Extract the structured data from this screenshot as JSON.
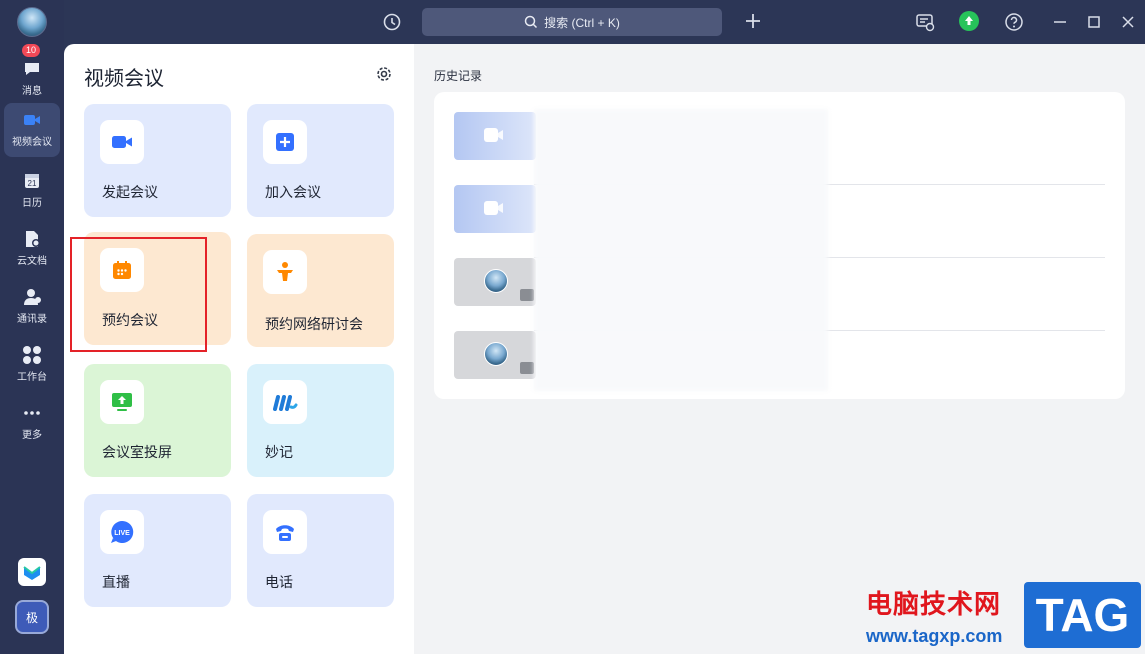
{
  "sidebar": {
    "items": [
      {
        "label": "消息",
        "badge": "10"
      },
      {
        "label": "视频会议"
      },
      {
        "label": "日历",
        "icon_text": "21"
      },
      {
        "label": "云文档"
      },
      {
        "label": "通讯录"
      },
      {
        "label": "工作台"
      },
      {
        "label": "更多"
      }
    ],
    "active": "视频会议",
    "account_label": "极"
  },
  "topbar": {
    "search_placeholder": "搜索 (Ctrl + K)"
  },
  "panel": {
    "title": "视频会议",
    "cards": [
      {
        "label": "发起会议",
        "icon": "video-camera-icon",
        "color": "#e1e9fd"
      },
      {
        "label": "加入会议",
        "icon": "plus-square-icon",
        "color": "#e1e9fd"
      },
      {
        "label": "预约会议",
        "icon": "calendar-icon",
        "color": "#fde8d1"
      },
      {
        "label": "预约网络研讨会",
        "icon": "webinar-podium-icon",
        "color": "#fde8d1"
      },
      {
        "label": "会议室投屏",
        "icon": "screen-cast-icon",
        "color": "#dbf5d6"
      },
      {
        "label": "妙记",
        "icon": "minutes-logo-icon",
        "color": "#d9f1fb"
      },
      {
        "label": "直播",
        "icon": "live-icon",
        "color": "#e1e9fd"
      },
      {
        "label": "电话",
        "icon": "telephone-icon",
        "color": "#e1e9fd"
      }
    ]
  },
  "history": {
    "title": "历史记录",
    "rows": [
      {
        "thumb": "video"
      },
      {
        "thumb": "video"
      },
      {
        "thumb": "avatar"
      },
      {
        "thumb": "avatar"
      }
    ]
  },
  "watermark": {
    "cn": "电脑技术网",
    "url": "www.tagxp.com",
    "tag": "TAG"
  },
  "colors": {
    "accent": "#3370ff",
    "highlight": "#e42228",
    "rail": "#2b3455"
  }
}
